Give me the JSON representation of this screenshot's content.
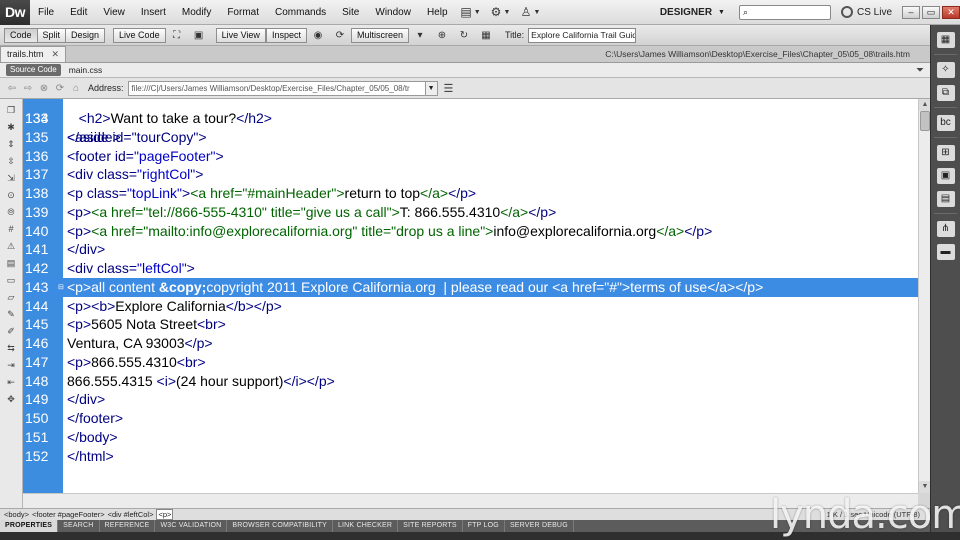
{
  "app": {
    "logo": "Dw",
    "menu": [
      "File",
      "Edit",
      "View",
      "Insert",
      "Modify",
      "Format",
      "Commands",
      "Site",
      "Window",
      "Help"
    ],
    "workspace": "DESIGNER",
    "search_placeholder": "",
    "cs_live": "CS Live"
  },
  "doc_toolbar": {
    "views": [
      "Code",
      "Split",
      "Design"
    ],
    "live_code": "Live Code",
    "live_view": "Live View",
    "inspect": "Inspect",
    "multiscreen": "Multiscreen",
    "title_label": "Title:",
    "title_value": "Explore California Trail Guide"
  },
  "tabs": {
    "active_file": "trails.htm",
    "path": "C:\\Users\\James Williamson\\Desktop\\Exercise_Files\\Chapter_05\\05_08\\trails.htm"
  },
  "related_files": {
    "source_code": "Source Code",
    "file": "main.css"
  },
  "address_bar": {
    "label": "Address:",
    "value": "file:///C|/Users/James Williamson/Desktop/Exercise_Files/Chapter_05/05_08/tr"
  },
  "code": {
    "partial_top": "<aside id=\"tourCopy\">",
    "lines": [
      {
        "n": "134",
        "indent": "   ",
        "tokens": [
          [
            "tag",
            "<h2>"
          ],
          [
            "text",
            "Want to take a tour?"
          ],
          [
            "tag",
            "</h2>"
          ]
        ]
      },
      {
        "n": "135",
        "indent": "",
        "tokens": [
          [
            "tag",
            "</aside>"
          ]
        ]
      },
      {
        "n": "136",
        "indent": "",
        "tokens": [
          [
            "tag",
            "<footer "
          ],
          [
            "attr",
            "id="
          ],
          [
            "val",
            "\"pageFooter\""
          ],
          [
            "tag",
            ">"
          ]
        ]
      },
      {
        "n": "137",
        "indent": "",
        "tokens": [
          [
            "tag",
            "<div "
          ],
          [
            "attr",
            "class="
          ],
          [
            "val",
            "\"rightCol\""
          ],
          [
            "tag",
            ">"
          ]
        ]
      },
      {
        "n": "138",
        "indent": "",
        "tokens": [
          [
            "tag",
            "<p "
          ],
          [
            "attr",
            "class="
          ],
          [
            "val",
            "\"topLink\""
          ],
          [
            "tag",
            ">"
          ],
          [
            "link",
            "<a href=\"#mainHeader\">"
          ],
          [
            "text",
            "return to top"
          ],
          [
            "link",
            "</a>"
          ],
          [
            "tag",
            "</p>"
          ]
        ]
      },
      {
        "n": "139",
        "indent": "",
        "tokens": [
          [
            "tag",
            "<p>"
          ],
          [
            "link",
            "<a href=\"tel://866-555-4310\" title=\"give us a call\">"
          ],
          [
            "text",
            "T: 866.555.4310"
          ],
          [
            "link",
            "</a>"
          ],
          [
            "tag",
            "</p>"
          ]
        ]
      },
      {
        "n": "140",
        "indent": "",
        "tokens": [
          [
            "tag",
            "<p>"
          ],
          [
            "link",
            "<a href=\"mailto:info@explorecalifornia.org\" title=\"drop us a line\">"
          ],
          [
            "text",
            "info@explorecalifornia.org"
          ],
          [
            "link",
            "</a>"
          ],
          [
            "tag",
            "</p>"
          ]
        ]
      },
      {
        "n": "141",
        "indent": "",
        "tokens": [
          [
            "tag",
            "</div>"
          ]
        ]
      },
      {
        "n": "142",
        "indent": "",
        "tokens": [
          [
            "tag",
            "<div "
          ],
          [
            "attr",
            "class="
          ],
          [
            "val",
            "\"leftCol\""
          ],
          [
            "tag",
            ">"
          ]
        ]
      },
      {
        "n": "143",
        "indent": "",
        "highlight": true,
        "tokens": [
          [
            "tag",
            "<p>"
          ],
          [
            "text",
            "all content "
          ],
          [
            "ent",
            "&copy;"
          ],
          [
            "text",
            "copyright 2011 Explore California.org  | please read our "
          ],
          [
            "link",
            "<a href=\"#\">"
          ],
          [
            "text",
            "terms of use"
          ],
          [
            "link",
            "</a>"
          ],
          [
            "tag",
            "</p>"
          ]
        ]
      },
      {
        "n": "144",
        "indent": "",
        "tokens": [
          [
            "tag",
            "<p><b>"
          ],
          [
            "text",
            "Explore California"
          ],
          [
            "tag",
            "</b></p>"
          ]
        ]
      },
      {
        "n": "145",
        "indent": "",
        "tokens": [
          [
            "tag",
            "<p>"
          ],
          [
            "text",
            "5605 Nota Street"
          ],
          [
            "tag",
            "<br>"
          ]
        ]
      },
      {
        "n": "146",
        "indent": "",
        "tokens": [
          [
            "text",
            "Ventura, CA 93003"
          ],
          [
            "tag",
            "</p>"
          ]
        ]
      },
      {
        "n": "147",
        "indent": "",
        "tokens": [
          [
            "tag",
            "<p>"
          ],
          [
            "text",
            "866.555.4310"
          ],
          [
            "tag",
            "<br>"
          ]
        ]
      },
      {
        "n": "148",
        "indent": "",
        "tokens": [
          [
            "text",
            "866.555.4315 "
          ],
          [
            "tag",
            "<i>"
          ],
          [
            "text",
            "(24 hour support)"
          ],
          [
            "tag",
            "</i></p>"
          ]
        ]
      },
      {
        "n": "149",
        "indent": "",
        "tokens": [
          [
            "tag",
            "</div>"
          ]
        ]
      },
      {
        "n": "150",
        "indent": "",
        "tokens": [
          [
            "tag",
            "</footer>"
          ]
        ]
      },
      {
        "n": "151",
        "indent": "",
        "tokens": [
          [
            "tag",
            "</body>"
          ]
        ]
      },
      {
        "n": "152",
        "indent": "",
        "tokens": [
          [
            "tag",
            "</html>"
          ]
        ]
      }
    ],
    "partial_top_number": "133"
  },
  "status_bar": {
    "tag_selector": [
      "<body>",
      "<footer #pageFooter>",
      "<div #leftCol>",
      "<p>"
    ],
    "right": "1 K / 1 sec  Unicode (UTF-8)"
  },
  "panel_tabs": [
    "PROPERTIES",
    "SEARCH",
    "REFERENCE",
    "W3C VALIDATION",
    "BROWSER COMPATIBILITY",
    "LINK CHECKER",
    "SITE REPORTS",
    "FTP LOG",
    "SERVER DEBUG"
  ],
  "watermark": "lynda.com",
  "colors": {
    "gutter": "#3c8ce0",
    "highlight": "#3d8ce3",
    "tag": "#000080",
    "value": "#0000c8",
    "link_tag": "#006400"
  }
}
